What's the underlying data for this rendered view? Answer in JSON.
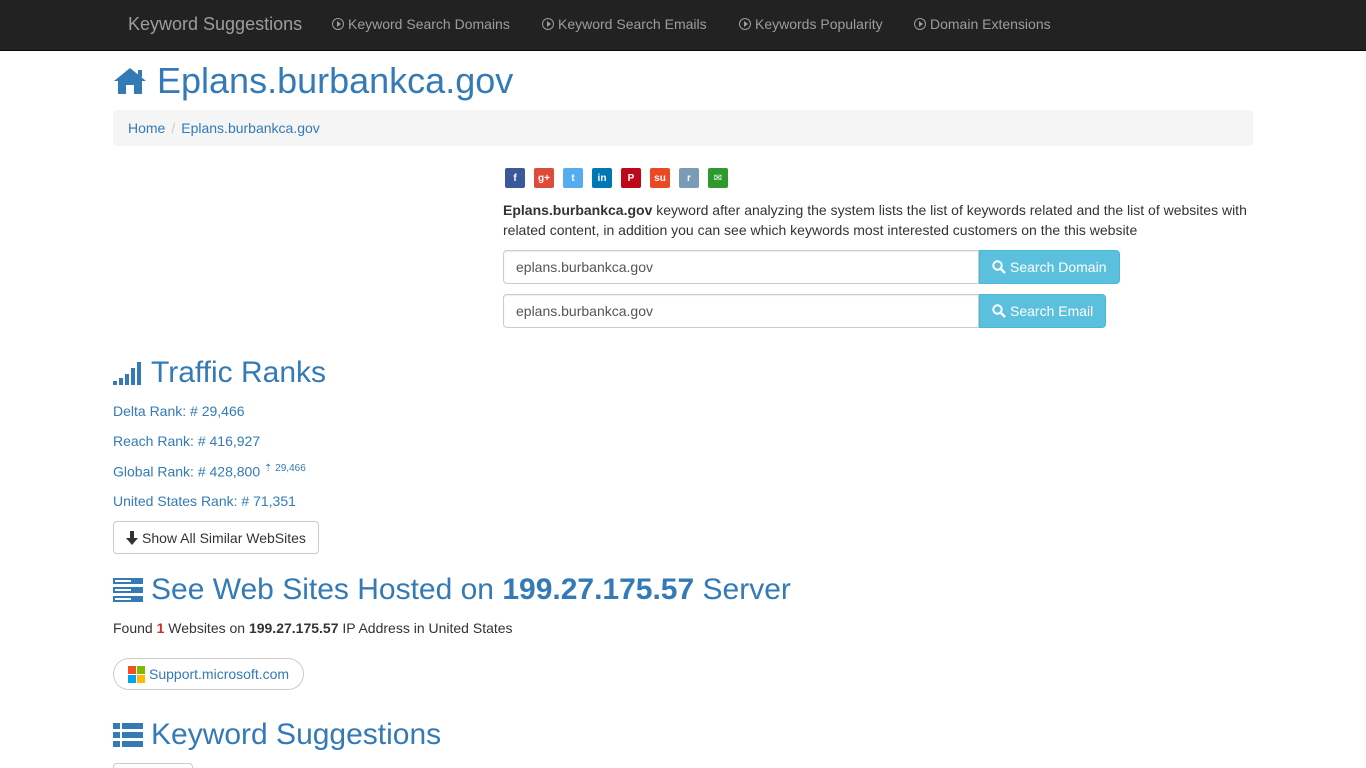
{
  "nav": {
    "brand": "Keyword Suggestions",
    "items": [
      {
        "label": "Keyword Search Domains"
      },
      {
        "label": "Keyword Search Emails"
      },
      {
        "label": "Keywords Popularity"
      },
      {
        "label": "Domain Extensions"
      }
    ]
  },
  "page_title": "Eplans.burbankca.gov",
  "breadcrumb": {
    "home": "Home",
    "current": "Eplans.burbankca.gov"
  },
  "share": [
    {
      "icon": "facebook-icon",
      "glyph": "f",
      "color": "#3b5998"
    },
    {
      "icon": "google-plus-icon",
      "glyph": "g+",
      "color": "#dd4b39"
    },
    {
      "icon": "twitter-icon",
      "glyph": "t",
      "color": "#55acee"
    },
    {
      "icon": "linkedin-icon",
      "glyph": "in",
      "color": "#0077b5"
    },
    {
      "icon": "pinterest-icon",
      "glyph": "P",
      "color": "#bd081c"
    },
    {
      "icon": "stumbleupon-icon",
      "glyph": "su",
      "color": "#eb4924"
    },
    {
      "icon": "reddit-icon",
      "glyph": "r",
      "color": "#7a9bb5"
    },
    {
      "icon": "email-icon",
      "glyph": "✉",
      "color": "#2e9a2e"
    }
  ],
  "description": {
    "bold": "Eplans.burbankca.gov",
    "text": " keyword after analyzing the system lists the list of keywords related and the list of websites with related content, in addition you can see which keywords most interested customers on the this website"
  },
  "search_domain": {
    "value": "eplans.burbankca.gov",
    "button": "Search Domain"
  },
  "search_email": {
    "value": "eplans.burbankca.gov",
    "button": "Search Email"
  },
  "traffic": {
    "title": "Traffic Ranks",
    "delta": "Delta Rank: # 29,466",
    "reach": "Reach Rank: # 416,927",
    "global": "Global Rank: # 428,800",
    "global_change": "29,466",
    "us": "United States Rank: # 71,351",
    "show_all": "Show All Similar WebSites"
  },
  "hosted": {
    "title_pre": "See Web Sites Hosted on ",
    "ip": "199.27.175.57",
    "title_post": " Server",
    "found_pre": "Found ",
    "count": "1",
    "found_mid": " Websites on ",
    "found_post": " IP Address in United States",
    "site": "Support.microsoft.com"
  },
  "keywords": {
    "title": "Keyword Suggestions"
  }
}
